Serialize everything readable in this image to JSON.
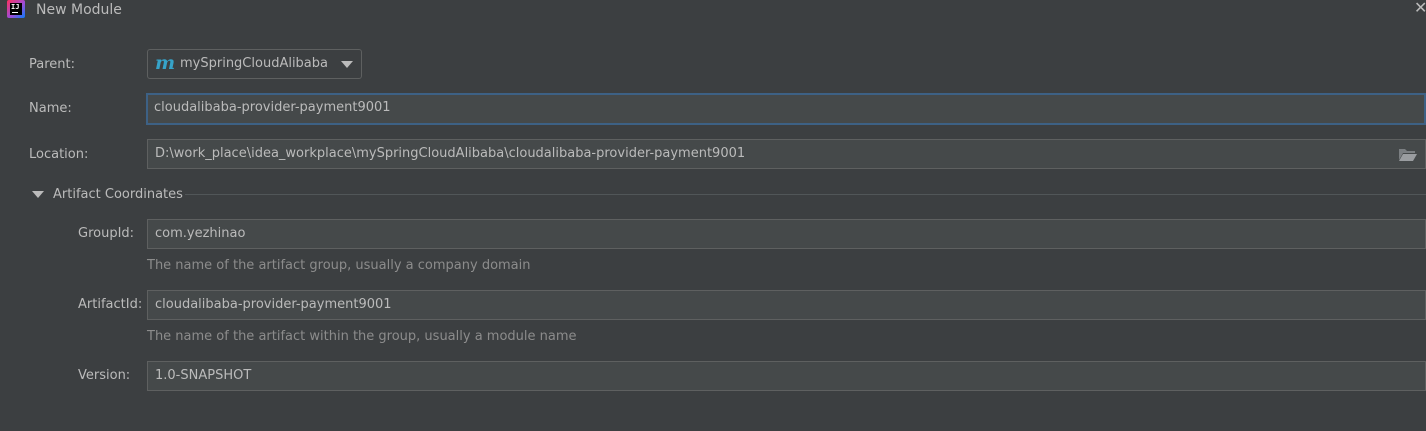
{
  "window": {
    "title": "New Module"
  },
  "form": {
    "parent": {
      "label": "Parent:",
      "value": "mySpringCloudAlibaba"
    },
    "name": {
      "label": "Name:",
      "value": "cloudalibaba-provider-payment9001"
    },
    "location": {
      "label": "Location:",
      "value": "D:\\work_place\\idea_workplace\\mySpringCloudAlibaba\\cloudalibaba-provider-payment9001"
    }
  },
  "artifact": {
    "section_title": "Artifact Coordinates",
    "group_id": {
      "label": "GroupId:",
      "value": "com.yezhinao",
      "hint": "The name of the artifact group, usually a company domain"
    },
    "artifact_id": {
      "label": "ArtifactId:",
      "value": "cloudalibaba-provider-payment9001",
      "hint": "The name of the artifact within the group, usually a module name"
    },
    "version": {
      "label": "Version:",
      "value": "1.0-SNAPSHOT"
    }
  },
  "colors": {
    "background": "#3c3f41",
    "field_background": "#45494a",
    "focus_border": "#3d6185",
    "maven_icon": "#36a3c9"
  }
}
